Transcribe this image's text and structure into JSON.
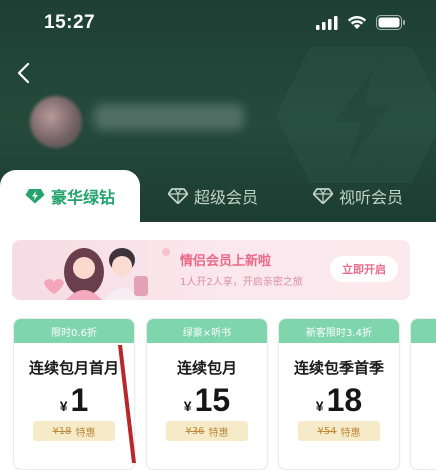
{
  "status_bar": {
    "time": "15:27"
  },
  "tabs": [
    {
      "label": "豪华绿钻"
    },
    {
      "label": "超级会员"
    },
    {
      "label": "视听会员"
    }
  ],
  "banner": {
    "title": "情侣会员上新啦",
    "subtitle": "1人开2人享，开启亲密之旅",
    "button": "立即开启"
  },
  "cards": [
    {
      "tag": "限时0.6折",
      "title": "连续包月首月",
      "currency": "¥",
      "price": "1",
      "original": "¥18",
      "discount_label": "特惠"
    },
    {
      "tag": "绿豪×听书",
      "title": "连续包月",
      "currency": "¥",
      "price": "15",
      "original": "¥36",
      "discount_label": "特惠"
    },
    {
      "tag": "新客限时3.4折",
      "title": "连续包季首季",
      "currency": "¥",
      "price": "18",
      "original": "¥54",
      "discount_label": "特惠"
    }
  ],
  "colors": {
    "header_bg": "#1e3f34",
    "accent_green": "#24a36d",
    "tag_green": "#7fd6ac",
    "banner_pink": "#ea6a88",
    "discount_gold": "#bf8a3e"
  },
  "icons": {
    "back": "chevron-left-icon",
    "tab1": "lightning-diamond-icon",
    "tab2": "diamond-icon",
    "tab3": "diamond-icon"
  }
}
